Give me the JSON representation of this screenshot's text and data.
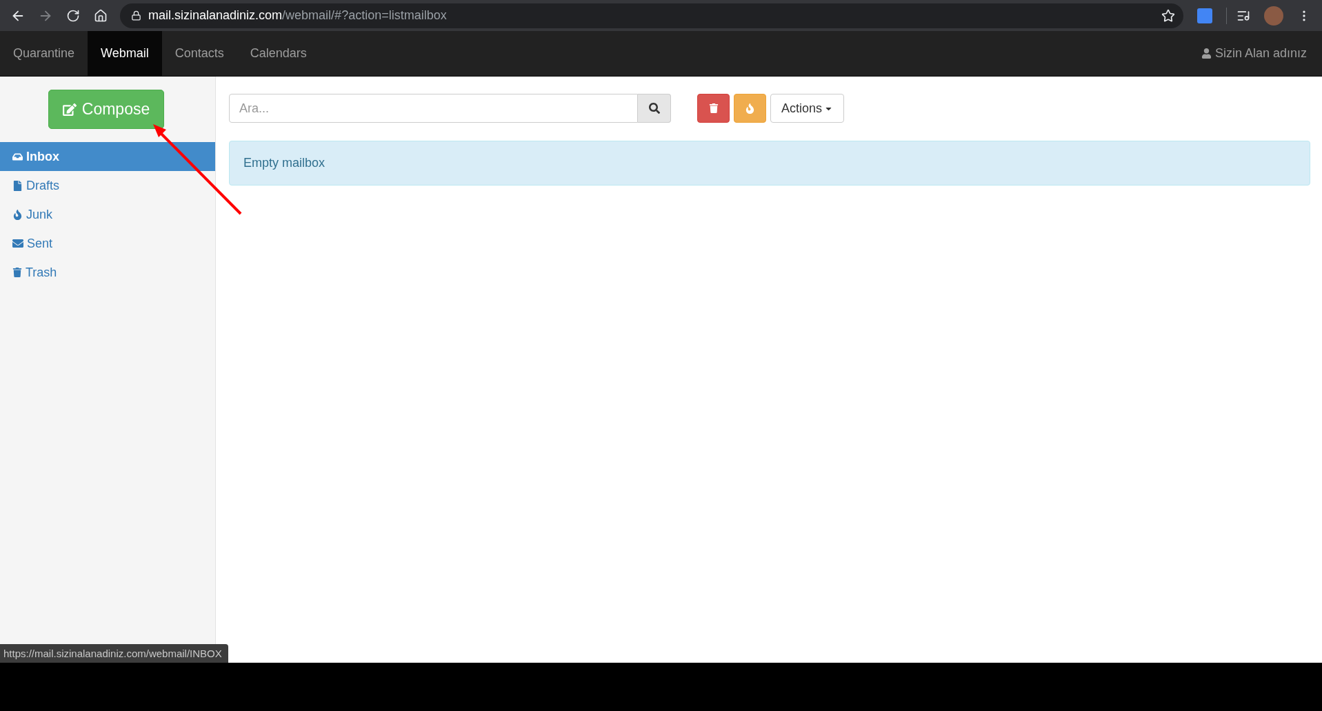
{
  "browser": {
    "url_host": "mail.sizinalanadiniz.com",
    "url_path": "/webmail/#?action=listmailbox",
    "forward_disabled": true
  },
  "nav": {
    "tabs": [
      {
        "label": "Quarantine",
        "selected": false
      },
      {
        "label": "Webmail",
        "selected": true
      },
      {
        "label": "Contacts",
        "selected": false
      },
      {
        "label": "Calendars",
        "selected": false
      }
    ],
    "user": "Sizin Alan adınız"
  },
  "sidebar": {
    "compose": "Compose",
    "folders": [
      {
        "kind": "inbox",
        "label": "Inbox",
        "selected": true
      },
      {
        "kind": "drafts",
        "label": "Drafts",
        "selected": false
      },
      {
        "kind": "junk",
        "label": "Junk",
        "selected": false
      },
      {
        "kind": "sent",
        "label": "Sent",
        "selected": false
      },
      {
        "kind": "trash",
        "label": "Trash",
        "selected": false
      }
    ]
  },
  "toolbar": {
    "search": {
      "placeholder": "Ara..."
    },
    "actions": "Actions"
  },
  "message": "Empty mailbox",
  "status_bar": "https://mail.sizinalanadiniz.com/webmail/INBOX"
}
